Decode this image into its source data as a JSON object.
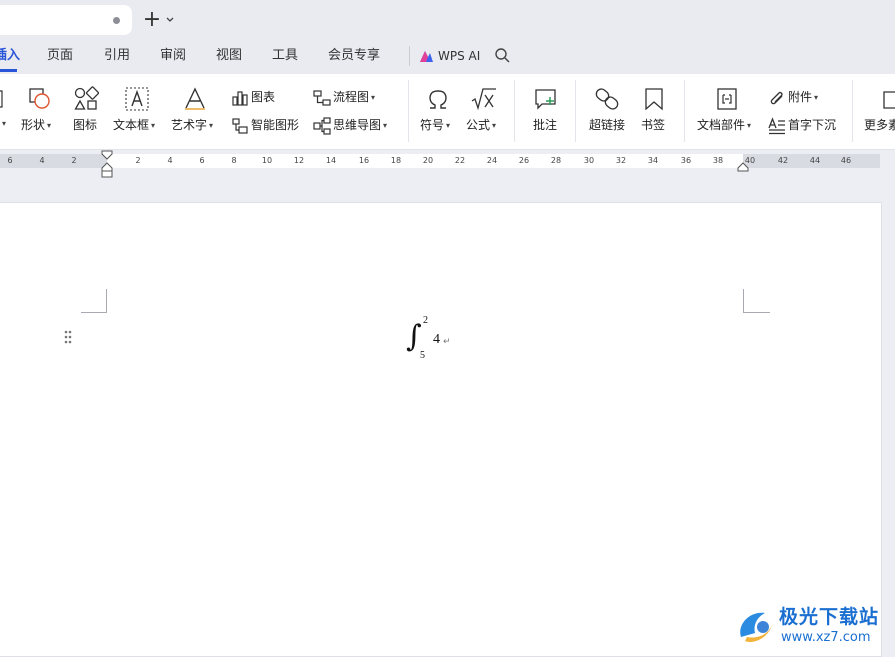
{
  "tabs": {
    "new_tab_label": "+"
  },
  "menu": {
    "tabs": [
      "插入",
      "页面",
      "引用",
      "审阅",
      "视图",
      "工具",
      "会员专享"
    ],
    "active_tab": "插入",
    "wps_ai_label": "WPS AI"
  },
  "ribbon": {
    "shape": "形状",
    "icon": "图标",
    "textbox": "文本框",
    "wordart": "艺术字",
    "chart": "图表",
    "smartart": "智能图形",
    "flowchart": "流程图",
    "mindmap": "思维导图",
    "symbol": "符号",
    "formula": "公式",
    "comment": "批注",
    "hyperlink": "超链接",
    "bookmark": "书签",
    "doc_parts": "文档部件",
    "attachment": "附件",
    "dropcap": "首字下沉",
    "more": "更多素材"
  },
  "ruler": {
    "labels": [
      "6",
      "4",
      "2",
      "2",
      "4",
      "6",
      "8",
      "10",
      "12",
      "14",
      "16",
      "18",
      "20",
      "22",
      "24",
      "26",
      "28",
      "30",
      "32",
      "34",
      "36",
      "38",
      "40",
      "42",
      "44",
      "46"
    ]
  },
  "document": {
    "formula": {
      "upper_limit": "2",
      "lower_limit": "5",
      "integrand": "4"
    },
    "paragraph_mark": "↵"
  },
  "watermark": {
    "title": "极光下载站",
    "url": "www.xz7.com"
  },
  "colors": {
    "accent": "#2955d9",
    "watermark": "#1b6fd1"
  }
}
